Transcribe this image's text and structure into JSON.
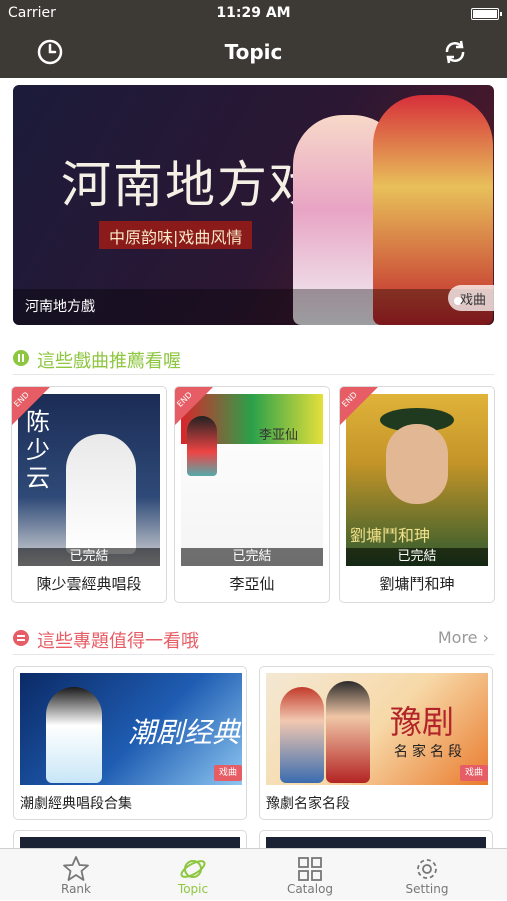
{
  "status_bar": {
    "carrier": "Carrier",
    "time": "11:29 AM"
  },
  "nav": {
    "title": "Topic",
    "left_icon": "clock-icon",
    "right_icon": "refresh-icon"
  },
  "banner": {
    "headline": "河南地方戏",
    "tagline": "中原韵味|戏曲风情",
    "caption": "河南地方戲",
    "tag": "戏曲"
  },
  "section_recommend": {
    "title": "這些戲曲推薦看喔"
  },
  "recommend_cards": [
    {
      "name": "陳少雲經典唱段",
      "status": "已完結",
      "end_badge": "END",
      "cover_text": "陈少云"
    },
    {
      "name": "李亞仙",
      "status": "已完結",
      "end_badge": "END",
      "cover_text": "李亚仙"
    },
    {
      "name": "劉墉鬥和珅",
      "status": "已完結",
      "end_badge": "END",
      "cover_text": "劉墉鬥和珅"
    }
  ],
  "section_topics": {
    "title": "這些專題值得一看哦",
    "more": "More ›"
  },
  "topic_cards": [
    {
      "name": "潮劇經典唱段合集",
      "cover_text": "潮剧经典",
      "chip": "戏曲"
    },
    {
      "name": "豫劇名家名段",
      "cover_text": "豫剧",
      "cover_sub": "名家名段",
      "chip": "戏曲"
    }
  ],
  "tabs": [
    {
      "label": "Rank",
      "icon": "star-icon",
      "active": false
    },
    {
      "label": "Topic",
      "icon": "planet-icon",
      "active": true
    },
    {
      "label": "Catalog",
      "icon": "grid-icon",
      "active": false
    },
    {
      "label": "Setting",
      "icon": "gear-icon",
      "active": false
    }
  ],
  "colors": {
    "accent_green": "#8dc63f",
    "accent_red": "#e75d65",
    "bar_dark": "#3d3934"
  }
}
